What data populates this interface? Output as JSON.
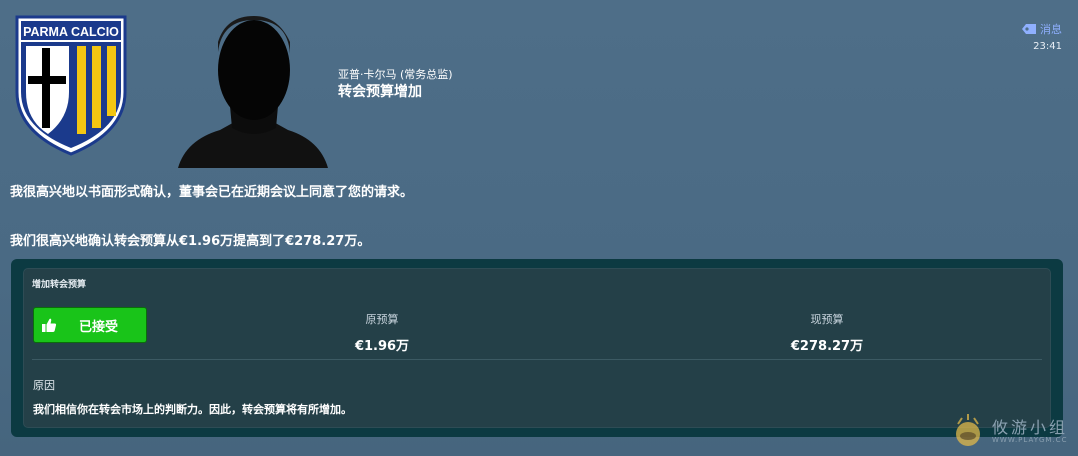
{
  "club": {
    "crest_text": "PARMA CALCIO"
  },
  "header": {
    "sender_name": "亚普·卡尔马 (常务总监)",
    "subject": "转会预算增加",
    "inbox_label": "消息",
    "time": "23:41"
  },
  "message": {
    "line1": "我很高兴地以书面形式确认，董事会已在近期会议上同意了您的请求。",
    "line2": "我们很高兴地确认转会预算从€1.96万提高到了€278.27万。"
  },
  "card": {
    "title": "增加转会预算",
    "accept_label": "已接受",
    "old_label": "原预算",
    "old_value": "€1.96万",
    "new_label": "现预算",
    "new_value": "€278.27万",
    "reason_heading": "原因",
    "reason_text": "我们相信你在转会市场上的判断力。因此，转会预算将有所增加。"
  },
  "watermark": {
    "text_cn": "攸游小组",
    "url": "WWW.PLAYGM.CC"
  },
  "colors": {
    "accent": "#19c419",
    "link": "#8fb0ff",
    "crest_blue": "#1b3a8c",
    "crest_gold": "#f3c612"
  }
}
